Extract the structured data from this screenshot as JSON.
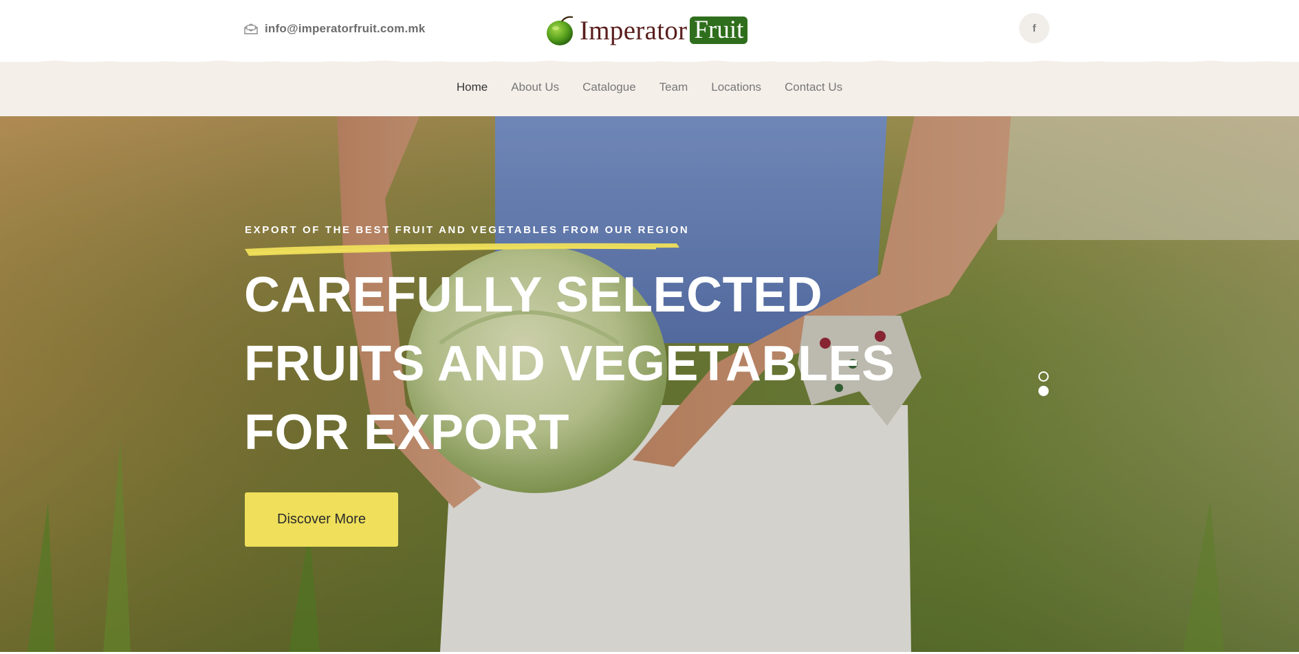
{
  "header": {
    "email": "info@imperatorfruit.com.mk",
    "email_icon": "envelope-icon",
    "logo": {
      "word1": "Imperator",
      "word2": "Fruit",
      "icon": "green-apple-icon",
      "brand_green": "#2f6e1d",
      "brand_maroon": "#5a1e1e"
    },
    "social": {
      "facebook_label": "f",
      "icon": "facebook-icon"
    }
  },
  "nav": {
    "items": [
      {
        "label": "Home",
        "active": true
      },
      {
        "label": "About Us",
        "active": false
      },
      {
        "label": "Catalogue",
        "active": false
      },
      {
        "label": "Team",
        "active": false
      },
      {
        "label": "Locations",
        "active": false
      },
      {
        "label": "Contact Us",
        "active": false
      }
    ],
    "background": "#f5efea"
  },
  "hero": {
    "kicker": "EXPORT OF THE BEST FRUIT AND VEGETABLES FROM OUR REGION",
    "headline": [
      "CAREFULLY SELECTED",
      "FRUITS AND VEGETABLES",
      "FOR EXPORT"
    ],
    "cta_label": "Discover More",
    "accent": "#efdf5a",
    "slides": 2,
    "active_slide": 2
  }
}
